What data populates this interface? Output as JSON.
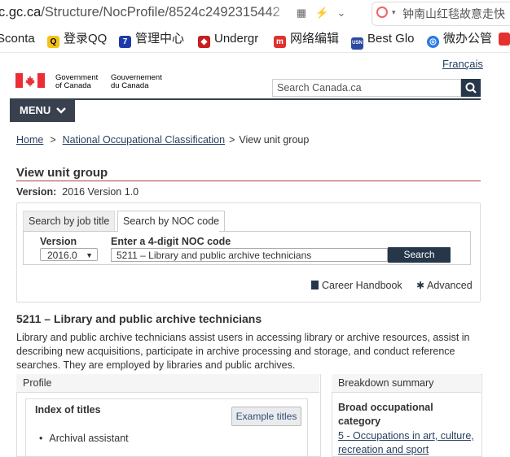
{
  "browser": {
    "url_host": "c.gc.ca",
    "url_path": "/Structure/NocProfile/8524c2492315442",
    "search_query": "钟南山红毯故意走快",
    "bookmarks": [
      {
        "label": "Sconta",
        "icon": "",
        "color": "#ffffff"
      },
      {
        "label": "登录QQ",
        "icon": "qq-icon",
        "color": "#e8b410"
      },
      {
        "label": "管理中心",
        "icon": "7",
        "color": "#1e3aa8"
      },
      {
        "label": "Undergr",
        "icon": "shield-icon",
        "color": "#c62020"
      },
      {
        "label": "网络编辑",
        "icon": "m",
        "color": "#e03030"
      },
      {
        "label": "Best Glo",
        "icon": "USN",
        "color": "#2b4aa0"
      },
      {
        "label": "微办公管",
        "icon": "circle-icon",
        "color": "#2a7be4"
      }
    ]
  },
  "header": {
    "lang_link": "Français",
    "gov_en_line1": "Government",
    "gov_en_line2": "of Canada",
    "gov_fr_line1": "Gouvernement",
    "gov_fr_line2": "du Canada",
    "search_placeholder": "Search Canada.ca",
    "menu_label": "MENU"
  },
  "breadcrumb": [
    "Home",
    "National Occupational Classification",
    "View unit group"
  ],
  "page": {
    "title": "View unit group",
    "version_label": "Version:",
    "version_value": "2016 Version 1.0"
  },
  "search": {
    "tab_job": "Search by job title",
    "tab_noc": "Search by NOC code",
    "version_label": "Version",
    "version_selected": "2016.0",
    "noc_label": "Enter a 4-digit NOC code",
    "noc_value": "5211 – Library and public archive technicians",
    "search_button": "Search",
    "career_link": "Career Handbook",
    "advanced_link": "Advanced"
  },
  "unit": {
    "title": "5211 – Library and public archive technicians",
    "description": "Library and public archive technicians assist users in accessing library or archive resources, assist in describing new acquisitions, participate in archive processing and storage, and conduct reference searches. They are employed by libraries and public archives."
  },
  "profile": {
    "heading": "Profile",
    "index_title": "Index of titles",
    "example_button": "Example titles",
    "items": [
      "Archival assistant"
    ]
  },
  "breakdown": {
    "heading": "Breakdown summary",
    "broad_title": "Broad occupational category",
    "broad_link": "5 - Occupations in art, culture, recreation and sport"
  }
}
